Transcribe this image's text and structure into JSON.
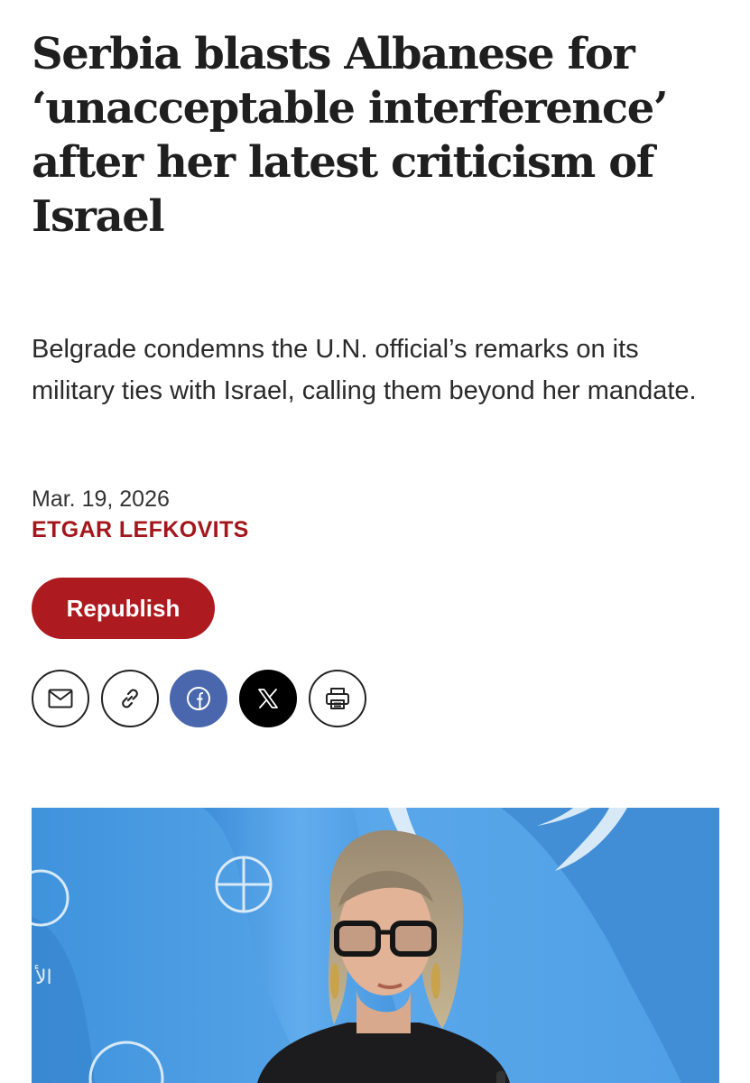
{
  "article": {
    "headline": "Serbia blasts Albanese for ‘unacceptable interference’ after her latest criticism of Israel",
    "subhead": "Belgrade condemns the U.N. official’s remarks on its military ties with Israel, calling them beyond her mandate.",
    "date": "Mar. 19, 2026",
    "author": "ETGAR LEFKOVITS",
    "republish_label": "Republish"
  },
  "share": {
    "buttons": [
      {
        "icon": "envelope-icon"
      },
      {
        "icon": "link-icon"
      },
      {
        "icon": "facebook-icon",
        "color": "#4a67ad"
      },
      {
        "icon": "x-icon",
        "color": "#000000"
      },
      {
        "icon": "printer-icon"
      }
    ]
  },
  "colors": {
    "accent": "#ad1a1f",
    "author": "#a3161b",
    "facebook": "#4a67ad",
    "photo_background": "#4b9de4"
  },
  "photo": {
    "watermark_text": "الأ"
  }
}
